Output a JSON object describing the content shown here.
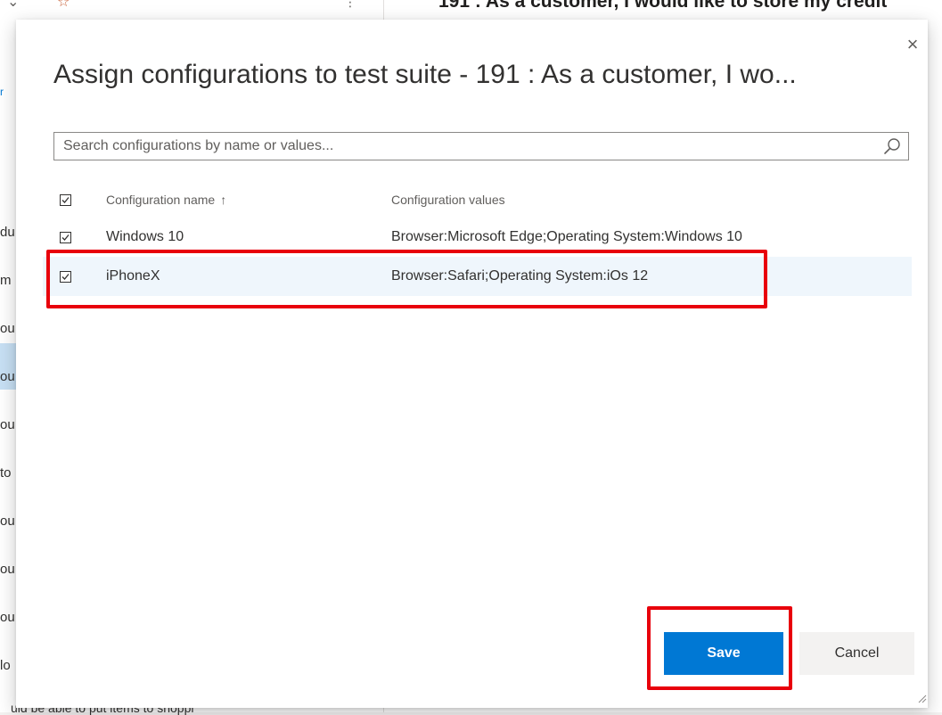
{
  "background": {
    "heading": "191 : As a customer, I would like to store my credit",
    "bottom_text": "uld be able to put items to shoppi",
    "left_fragments": [
      "du",
      "m",
      "ou",
      "ou",
      "ou",
      "to",
      "ou",
      "ou",
      "ou",
      "lo"
    ],
    "blue_fragment": "r"
  },
  "dialog": {
    "title": "Assign configurations to test suite - 191 : As a customer, I wo...",
    "close_label": "×",
    "search": {
      "placeholder": "Search configurations by name or values...",
      "value": ""
    },
    "table": {
      "columns": {
        "name": "Configuration name",
        "sort_indicator": "↑",
        "values": "Configuration values"
      },
      "rows": [
        {
          "name": "Windows 10",
          "values": "Browser:Microsoft Edge;Operating System:Windows 10",
          "checked": true
        },
        {
          "name": "iPhoneX",
          "values": "Browser:Safari;Operating System:iOs 12",
          "checked": true
        }
      ]
    },
    "buttons": {
      "save": "Save",
      "cancel": "Cancel"
    }
  },
  "colors": {
    "primary": "#0078d4",
    "annotation": "#e8000b",
    "selected_row": "#eff6fc"
  },
  "icons": {
    "search": "search-icon",
    "close": "close-icon",
    "check": "checkmark-icon",
    "sort": "arrow-up-icon"
  }
}
